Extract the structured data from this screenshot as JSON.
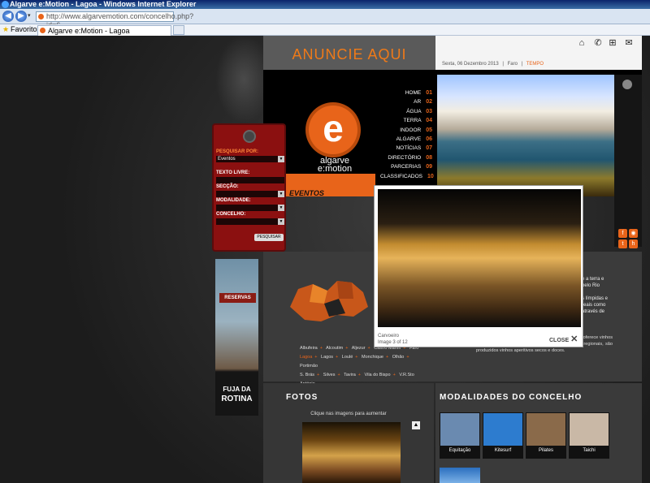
{
  "browser": {
    "title": "Algarve e:Motion - Lagoa - Windows Internet Explorer",
    "url": "http://www.algarvemotion.com/concelho.php?id=6",
    "favorites_label": "Favoritos",
    "tab_label": "Algarve e:Motion - Lagoa"
  },
  "banner": {
    "text": "ANUNCIE AQUI"
  },
  "topbar": {
    "date": "Sexta, 06 Dezembro 2013",
    "location": "Faro",
    "weather_link": "TEMPO",
    "icons": [
      "home-icon",
      "contact-icon",
      "sitemap-icon",
      "mail-icon"
    ]
  },
  "logo": {
    "letter": "e",
    "line1": "algarve",
    "line2": "e:motion"
  },
  "menu": [
    {
      "label": "HOME",
      "num": "01"
    },
    {
      "label": "AR",
      "num": "02"
    },
    {
      "label": "ÁGUA",
      "num": "03"
    },
    {
      "label": "TERRA",
      "num": "04"
    },
    {
      "label": "INDOOR",
      "num": "05"
    },
    {
      "label": "ALGARVE",
      "num": "06"
    },
    {
      "label": "NOTÍCIAS",
      "num": "07"
    },
    {
      "label": "DIRECTÓRIO",
      "num": "08"
    },
    {
      "label": "PARCERIAS",
      "num": "09"
    },
    {
      "label": "CLASSIFICADOS",
      "num": "10"
    }
  ],
  "section_label": "EVENTOS",
  "search": {
    "title": "PESQUISAR POR:",
    "type_value": "Eventos",
    "free_text_label": "TEXTO LIVRE:",
    "section_label": "SECÇÃO:",
    "modality_label": "MODALIDADE:",
    "council_label": "CONCELHO:",
    "button": "PESQUISAR"
  },
  "reservas": {
    "sign": "RESERVAS",
    "slogan1": "FUJA DA",
    "slogan2": "ROTINA"
  },
  "concelhos": [
    "Albufeira",
    "Alcoutim",
    "Aljezur",
    "Castro Marim",
    "Faro",
    "Lagoa",
    "Lagos",
    "Loulé",
    "Monchique",
    "Olhão",
    "Portimão",
    "S. Brás",
    "Silves",
    "Tavira",
    "Vila do Bispo",
    "V.R.Sto António"
  ],
  "description": {
    "fragment1": "e a terra e",
    "fragment2": "pelo Rio",
    "fragment3": "s límpidas e",
    "fragment4": "reais como",
    "fragment5": "através de",
    "paragraph": "envolvimento empreila Igualmente nesta região, que oferece vinhos brancos e tintos. Igualmente a partir destas castas regionais, são produzidos vinhos aperitivos secos e doces."
  },
  "fotos": {
    "title": "FOTOS",
    "hint": "Clique nas imagens para aumentar"
  },
  "modalidades": {
    "title": "MODALIDADES DO CONCELHO",
    "items": [
      {
        "label": "Equitação",
        "color": "#6a8ab0"
      },
      {
        "label": "Kitesurf",
        "color": "#2d7ccf"
      },
      {
        "label": "Pilates",
        "color": "#8a6a4a"
      },
      {
        "label": "Taichi",
        "color": "#c9b8a6"
      }
    ]
  },
  "lightbox": {
    "caption": "Carvoeiro",
    "counter": "Image 3 of 12",
    "close": "CLOSE"
  },
  "colors": {
    "accent": "#e8641a",
    "search_panel": "#8b1010"
  }
}
